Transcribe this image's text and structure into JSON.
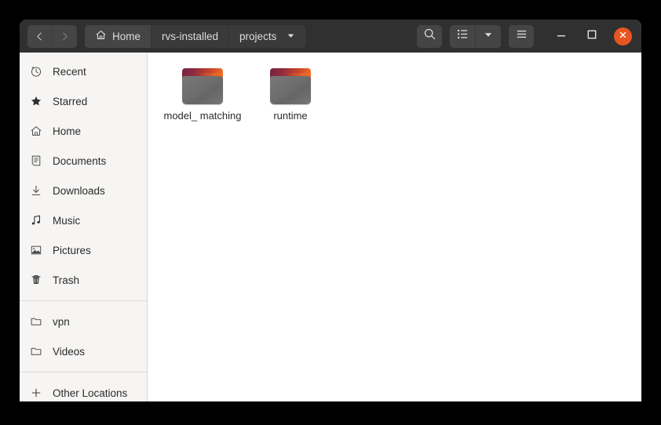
{
  "window": {
    "titlebar": {
      "nav": {
        "back_label": "Back",
        "forward_label": "Forward"
      },
      "breadcrumbs": [
        {
          "label": "Home",
          "icon": "home-icon",
          "active": true
        },
        {
          "label": "rvs-installed",
          "icon": "",
          "active": false
        },
        {
          "label": "projects",
          "icon": "",
          "active": false,
          "has_dropdown": true
        }
      ],
      "buttons": {
        "search_label": "Search",
        "view_list_label": "List View",
        "view_dropdown_label": "View Options",
        "menu_label": "Main Menu",
        "minimize_label": "Minimize",
        "maximize_label": "Maximize",
        "close_label": "Close"
      }
    },
    "sidebar": {
      "groups": [
        {
          "items": [
            {
              "label": "Recent",
              "icon": "clock-icon"
            },
            {
              "label": "Starred",
              "icon": "star-icon"
            },
            {
              "label": "Home",
              "icon": "home-icon"
            },
            {
              "label": "Documents",
              "icon": "document-icon"
            },
            {
              "label": "Downloads",
              "icon": "download-icon"
            },
            {
              "label": "Music",
              "icon": "music-note-icon"
            },
            {
              "label": "Pictures",
              "icon": "image-icon"
            },
            {
              "label": "Trash",
              "icon": "trash-icon"
            }
          ]
        },
        {
          "items": [
            {
              "label": "vpn",
              "icon": "folder-icon"
            },
            {
              "label": "Videos",
              "icon": "folder-icon"
            }
          ]
        },
        {
          "items": [
            {
              "label": "Other Locations",
              "icon": "plus-icon"
            }
          ]
        }
      ]
    },
    "files": [
      {
        "name": "model_matching",
        "display": "model_\nmatching",
        "type": "folder"
      },
      {
        "name": "runtime",
        "display": "runtime",
        "type": "folder"
      }
    ]
  },
  "colors": {
    "headerbar": "#303030",
    "button": "#454545",
    "close_accent": "#e95420",
    "sidebar_bg": "#f6f5f4",
    "content_bg": "#ffffff",
    "folder_body": "#6e6e6e",
    "folder_tab_start": "#77243f",
    "folder_tab_end": "#f4702a",
    "text_light": "#dcdcdc",
    "text_dark": "#2b2b2b",
    "desktop_bg": "#000000"
  }
}
